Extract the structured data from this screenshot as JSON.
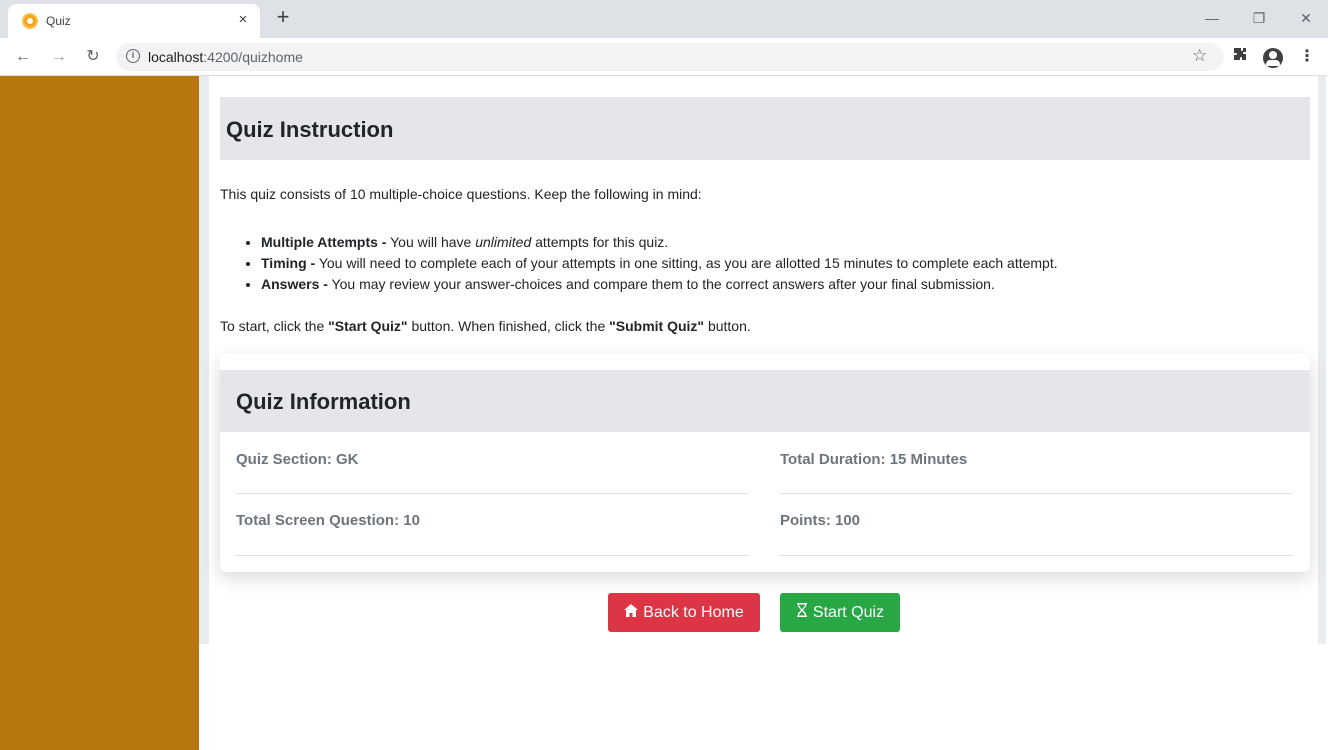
{
  "browser": {
    "tab_title": "Quiz",
    "tab_close": "×",
    "new_tab": "+",
    "url_host": "localhost",
    "url_rest": ":4200/quizhome",
    "window_controls": {
      "minimize": "—",
      "restore": "❐",
      "close": "✕"
    }
  },
  "instruction": {
    "heading": "Quiz Instruction",
    "intro": "This quiz consists of 10 multiple-choice questions. Keep the following in mind:",
    "bullets": [
      {
        "label": "Multiple Attempts -",
        "pre": " You will have ",
        "em": "unlimited",
        "post": " attempts for this quiz."
      },
      {
        "label": "Timing -",
        "text": " You will need to complete each of your attempts in one sitting, as you are allotted 15 minutes to complete each attempt."
      },
      {
        "label": "Answers -",
        "text": " You may review your answer-choices and compare them to the correct answers after your final submission."
      }
    ],
    "start_note": {
      "p1": "To start, click the ",
      "b1": "\"Start Quiz\"",
      "p2": " button. When finished, click the ",
      "b2": "\"Submit Quiz\"",
      "p3": " button."
    }
  },
  "info": {
    "heading": "Quiz Information",
    "quiz_section": "Quiz Section: GK",
    "total_duration": "Total Duration: 15 Minutes",
    "total_questions": "Total Screen Question: 10",
    "points": "Points: 100"
  },
  "buttons": {
    "back_home": "Back to Home",
    "start_quiz": "Start Quiz"
  },
  "colors": {
    "sidebar": "#b8760e",
    "back_button": "#dc3545",
    "start_button": "#28a745",
    "heading_bg": "#e4e6e9"
  },
  "icons": {
    "back_home": "home-icon",
    "start_quiz": "hourglass-icon"
  }
}
